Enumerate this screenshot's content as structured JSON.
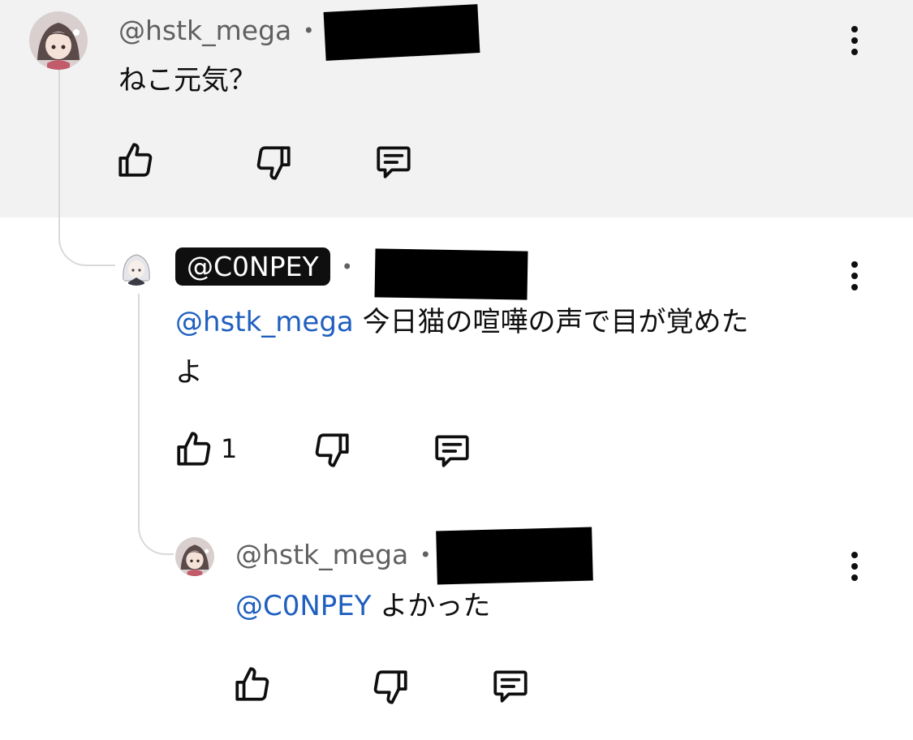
{
  "comments": [
    {
      "author": "@hstk_mega",
      "separator": "•",
      "text": "ねこ元気？",
      "avatar_icon": "anime-girl-avatar",
      "highlighted": true,
      "like_count": ""
    },
    {
      "author": "@C0NPEY",
      "separator": "•",
      "mention": "@hstk_mega",
      "text_line1": "今日猫の喧嘩の声で目が覚めた",
      "text_line2": "よ",
      "avatar_icon": "white-hair-character-avatar",
      "author_is_owner": true,
      "like_count": "1"
    },
    {
      "author": "@hstk_mega",
      "separator": "•",
      "mention": "@C0NPEY",
      "text": "よかった",
      "avatar_icon": "anime-girl-avatar",
      "like_count": ""
    }
  ],
  "icons": {
    "like": "thumbs-up-icon",
    "dislike": "thumbs-down-icon",
    "reply": "reply-icon",
    "more": "more-vertical-icon"
  },
  "colors": {
    "highlight_background": "#f2f2f2",
    "mention": "#1f5fbf",
    "owner_chip": "#0f0f0f",
    "secondary_text": "#606060"
  }
}
